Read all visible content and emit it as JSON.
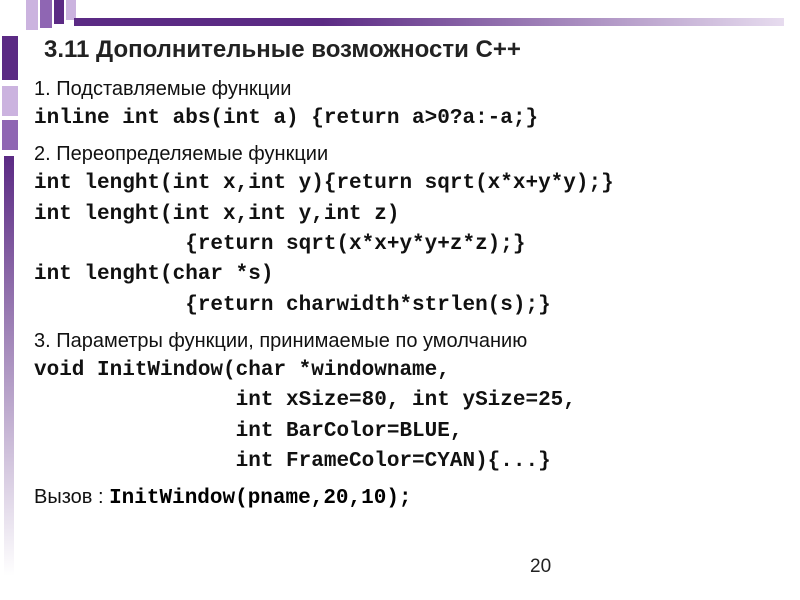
{
  "title": "3.11 Дополнительные возможности С++",
  "sec1": {
    "head": "1. Подставляемые функции",
    "line1": "inline int abs(int a) {return a>0?a:-a;}"
  },
  "sec2": {
    "head": "2. Переопределяемые функции",
    "l1": "int lenght(int x,int y){return sqrt(x*x+y*y);}",
    "l2": "int lenght(int x,int y,int z)",
    "l3": "            {return sqrt(x*x+y*y+z*z);}",
    "l4": "int lenght(char *s)",
    "l5": "            {return charwidth*strlen(s);}"
  },
  "sec3": {
    "head": "3. Параметры функции, принимаемые по умолчанию",
    "l1": "void InitWindow(char *windowname,",
    "l2": "                int xSize=80, int ySize=25,",
    "l3": "                int BarColor=BLUE,",
    "l4": "                int FrameColor=CYAN){...}"
  },
  "call": {
    "label": "Вызов : ",
    "code": "InitWindow(pname,20,10);"
  },
  "pagenum": "20"
}
